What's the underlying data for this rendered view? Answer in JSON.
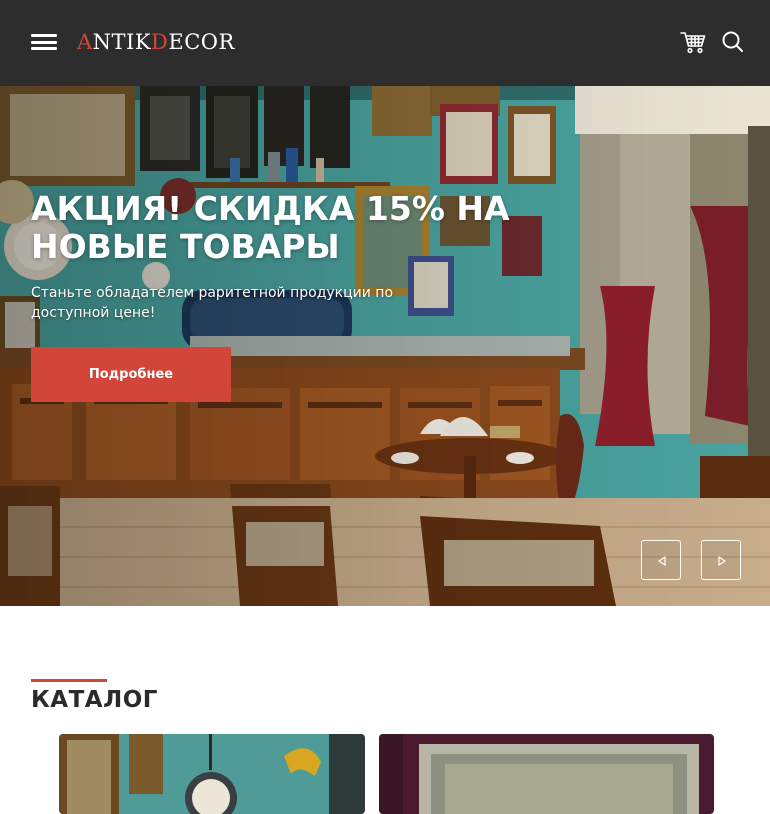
{
  "header": {
    "logo_first_letter": "A",
    "logo_mid": "NTIK",
    "logo_second_letter": "D",
    "logo_end": "ECOR",
    "menu_icon": "hamburger-menu-icon",
    "cart_icon": "shopping-cart-icon",
    "search_icon": "search-icon",
    "background": "#2d2d2d",
    "accent": "#d84436"
  },
  "hero": {
    "title": "Акция! Скидка 15% на новые товары",
    "subtitle": "Станьте обладателем раритетной продукции по доступной цене!",
    "button_label": "Подробнее",
    "button_color": "#d2463a",
    "prev_icon": "triangle-left-icon",
    "next_icon": "triangle-right-icon"
  },
  "catalog": {
    "title": "КАТАЛОГ",
    "accent": "#d2463a",
    "cards": [
      {
        "image": "antique-clock-photo"
      },
      {
        "image": "framed-painting-photo"
      }
    ]
  }
}
